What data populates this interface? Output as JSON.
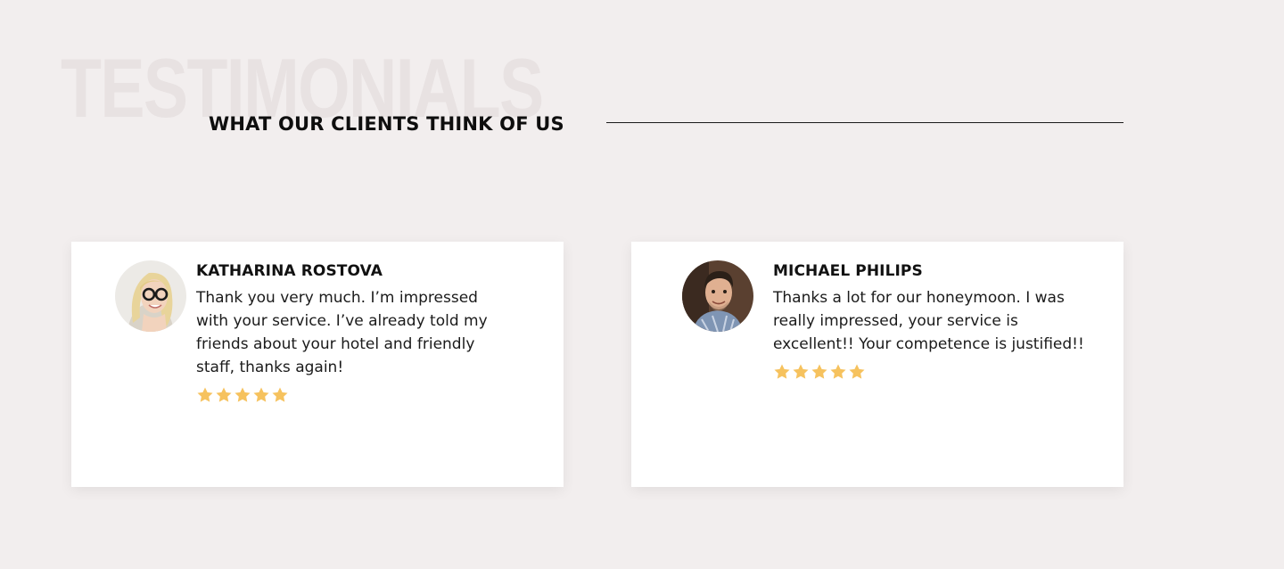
{
  "section": {
    "background_title": "TESTIMONIALS",
    "heading": "WHAT OUR CLIENTS THINK OF US"
  },
  "testimonials": [
    {
      "name": "KATHARINA ROSTOVA",
      "quote": "Thank you very much. I’m impressed with your service. I’ve already told my friends about your hotel and friendly staff, thanks again!",
      "rating": 5
    },
    {
      "name": "MICHAEL PHILIPS",
      "quote": "Thanks a lot for our honeymoon. I was really impressed, your service is excellent!! Your competence is justified!!",
      "rating": 5
    }
  ],
  "colors": {
    "background": "#f2eeee",
    "card": "#ffffff",
    "star": "#f6c25e",
    "text": "#111111"
  }
}
